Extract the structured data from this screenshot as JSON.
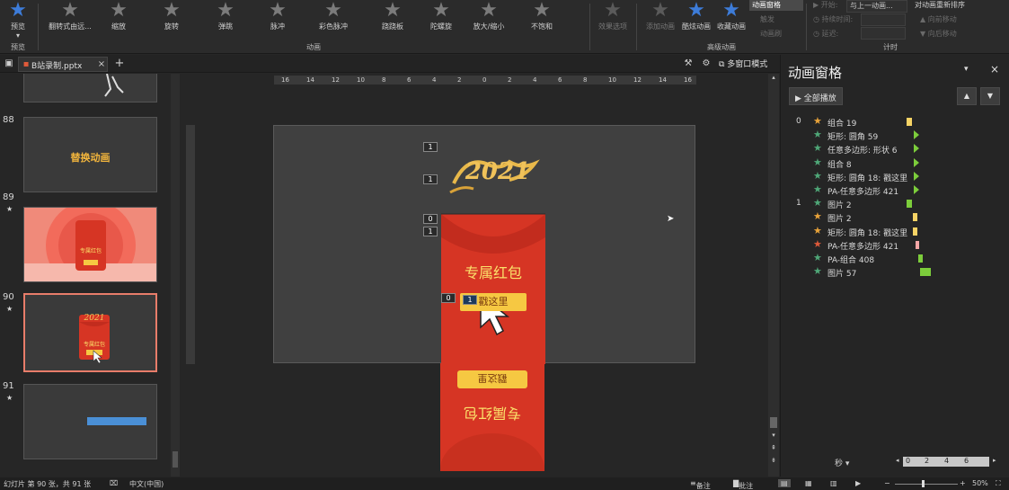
{
  "ribbon": {
    "preview_label": "预览",
    "preview_group": "预览",
    "anim_group": "动画",
    "advanced_group": "高级动画",
    "timing_group": "计时",
    "effects": [
      {
        "label": "翻转式由远..."
      },
      {
        "label": "缩放"
      },
      {
        "label": "旋转"
      },
      {
        "label": "弹跳"
      },
      {
        "label": "脉冲"
      },
      {
        "label": "彩色脉冲"
      },
      {
        "label": "跷跷板"
      },
      {
        "label": "陀螺旋"
      },
      {
        "label": "放大/缩小"
      },
      {
        "label": "不饱和"
      }
    ],
    "effect_options": "效果选项",
    "add_animation": "添加动画",
    "trigger": "触发",
    "animation_painter": "动画刷",
    "anim_pane_btn": "动画窗格",
    "custom_anim": "酷炫动画",
    "fav_anim": "收藏动画",
    "start_label": "开始:",
    "start_value": "与上一动画...",
    "duration_label": "持续时间:",
    "delay_label": "延迟:",
    "reorder_title": "对动画重新排序",
    "move_earlier": "向前移动",
    "move_later": "向后移动"
  },
  "tabbar": {
    "doc_tab": "B站录制.pptx",
    "multi_window": "多窗口模式"
  },
  "thumbnails": [
    {
      "num": "88",
      "star": "",
      "text": "替换动画"
    },
    {
      "num": "89",
      "star": "★"
    },
    {
      "num": "90",
      "star": "★"
    },
    {
      "num": "91",
      "star": "★"
    }
  ],
  "slide": {
    "envelope_text": "专属红包",
    "button_text": "戳这里",
    "year_text": "2021",
    "tags": [
      "1",
      "1",
      "0",
      "1",
      "0",
      "1"
    ]
  },
  "ruler_labels": [
    "16",
    "14",
    "12",
    "10",
    "8",
    "6",
    "4",
    "2",
    "0",
    "2",
    "4",
    "6",
    "8",
    "10",
    "12",
    "14",
    "16"
  ],
  "pane": {
    "title": "动画窗格",
    "play_all": "全部播放",
    "rows": [
      {
        "idx": "0",
        "name": "组合 19",
        "star_color": "#e8a33a",
        "bar_color": "#f6d365"
      },
      {
        "idx": "",
        "name": "矩形: 圆角 59",
        "star_color": "#4fa878",
        "bar_color": "#7ccd3b"
      },
      {
        "idx": "",
        "name": "任意多边形: 形状 6",
        "star_color": "#4fa878",
        "bar_color": "#7ccd3b"
      },
      {
        "idx": "",
        "name": "组合 8",
        "star_color": "#4fa878",
        "bar_color": "#7ccd3b"
      },
      {
        "idx": "",
        "name": "矩形: 圆角 18: 戳这里",
        "star_color": "#4fa878",
        "bar_color": "#7ccd3b"
      },
      {
        "idx": "",
        "name": "PA-任意多边形 421",
        "star_color": "#4fa878",
        "bar_color": "#7ccd3b"
      },
      {
        "idx": "1",
        "name": "图片 2",
        "star_color": "#4fa878",
        "bar_color": "#7ccd3b"
      },
      {
        "idx": "",
        "name": "图片 2",
        "star_color": "#e8a33a",
        "bar_color": "#f6d365"
      },
      {
        "idx": "",
        "name": "矩形: 圆角 18: 戳这里",
        "star_color": "#e8a33a",
        "bar_color": "#f6d365"
      },
      {
        "idx": "",
        "name": "PA-任意多边形 421",
        "star_color": "#e05a3a",
        "bar_color": "#f4a6a6"
      },
      {
        "idx": "",
        "name": "PA-组合 408",
        "star_color": "#4fa878",
        "bar_color": "#7ccd3b"
      },
      {
        "idx": "",
        "name": "图片 57",
        "star_color": "#4fa878",
        "bar_color": "#7ccd3b"
      }
    ],
    "seconds_label": "秒",
    "timeline_ticks": [
      "0",
      "2",
      "4",
      "6"
    ]
  },
  "status": {
    "slide_info": "幻灯片 第 90 张，共 91 张",
    "language": "中文(中国)",
    "notes": "备注",
    "comments": "批注",
    "zoom": "50%"
  }
}
